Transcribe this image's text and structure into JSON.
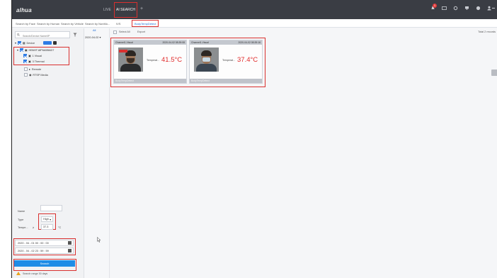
{
  "header": {
    "brand": "alhua",
    "nav": {
      "live": "LIVE",
      "ai_search": "AI SEARCH",
      "add": "+"
    },
    "notification_count": "1",
    "icons": [
      "notification-bell-icon",
      "display-icon",
      "settings-icon",
      "monitor-icon",
      "info-icon",
      "user-icon"
    ]
  },
  "tabs": [
    {
      "label": "Search by Face"
    },
    {
      "label": "Search by Human"
    },
    {
      "label": "Search by Vehicle"
    },
    {
      "label": "Search by NonMo..."
    },
    {
      "label": "IVS"
    },
    {
      "label": "BodyTempDetect"
    }
  ],
  "left_panel": {
    "search_placeholder": "Search/Device Name/IP",
    "tree": {
      "root": "Device",
      "device": "HBN9T18P6A5BAD7",
      "channels": [
        "1 Visual",
        "3 Thermal"
      ],
      "others": [
        "Remote",
        "RTSP Media"
      ]
    },
    "form": {
      "name_label": "Name",
      "name_value": "",
      "type_label": "Type",
      "type_value": "High",
      "temp_label": "Tempe...",
      "temp_op": "≥",
      "temp_value": "37.3",
      "temp_unit": "°C"
    },
    "dates": {
      "start": "2020 - 04 - 01   00 : 00 : 00",
      "end": "2020 - 04 - 02   23 : 59 : 59"
    },
    "search_button": "Search",
    "warning": "Search range 30 days"
  },
  "date_column": {
    "all_label": "All",
    "entries": [
      "2020-04-02"
    ]
  },
  "results": {
    "select_all": "Select All",
    "export_label": "Export",
    "total": "Total 2 records",
    "cards": [
      {
        "channel": "Channel1-Visual",
        "timestamp": "2020-04-02 08:39:08",
        "temp_label": "Temperat...",
        "temperature": "41.5°C",
        "footer": "BodyTempDetect"
      },
      {
        "channel": "Channel1-Visual",
        "timestamp": "2020-04-02 08:39:16",
        "temp_label": "Temperat...",
        "temperature": "37.4°C",
        "footer": "BodyTempDetect"
      }
    ]
  },
  "colors": {
    "annotation_red": "#d9302f",
    "accent_blue": "#1e8ce6",
    "temperature_red": "#e02b2b",
    "topbar": "#3a3d44"
  }
}
